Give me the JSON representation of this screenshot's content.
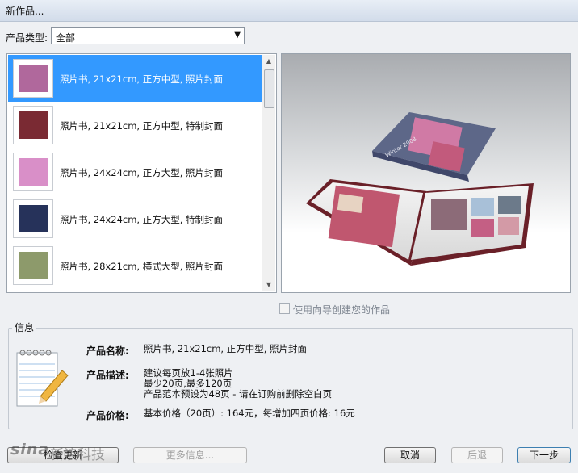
{
  "window": {
    "title": "新作品..."
  },
  "product_type": {
    "label": "产品类型:",
    "selected": "全部"
  },
  "products": [
    {
      "label": "照片书, 21x21cm, 正方中型, 照片封面",
      "selected": true,
      "thumb_color": "#b0689c"
    },
    {
      "label": "照片书, 21x21cm, 正方中型, 特制封面",
      "selected": false,
      "thumb_color": "#7a2a33"
    },
    {
      "label": "照片书, 24x24cm, 正方大型, 照片封面",
      "selected": false,
      "thumb_color": "#d98fc8"
    },
    {
      "label": "照片书, 24x24cm, 正方大型, 特制封面",
      "selected": false,
      "thumb_color": "#26325a"
    },
    {
      "label": "照片书, 28x21cm, 横式大型, 照片封面",
      "selected": false,
      "thumb_color": "#8d9a6b"
    }
  ],
  "preview": {
    "cover_text": "Winter 2008"
  },
  "wizard_checkbox": {
    "label": "使用向导创建您的作品",
    "checked": false
  },
  "info": {
    "title": "信息",
    "name_label": "产品名称:",
    "name_value": "照片书, 21x21cm, 正方中型, 照片封面",
    "desc_label": "产品描述:",
    "desc_lines": [
      "建议每页放1-4张照片",
      "最少20页,最多120页",
      "产品范本预设为48页 - 请在订购前删除空白页"
    ],
    "price_label": "产品价格:",
    "price_value": "基本价格（20页）: 164元，每增加四页价格: 16元"
  },
  "buttons": {
    "check_update": "检查更新",
    "more_info": "更多信息...",
    "cancel": "取消",
    "back": "后退",
    "next": "下一步"
  },
  "watermark": {
    "logo": "sina",
    "text": "新浪科技"
  }
}
